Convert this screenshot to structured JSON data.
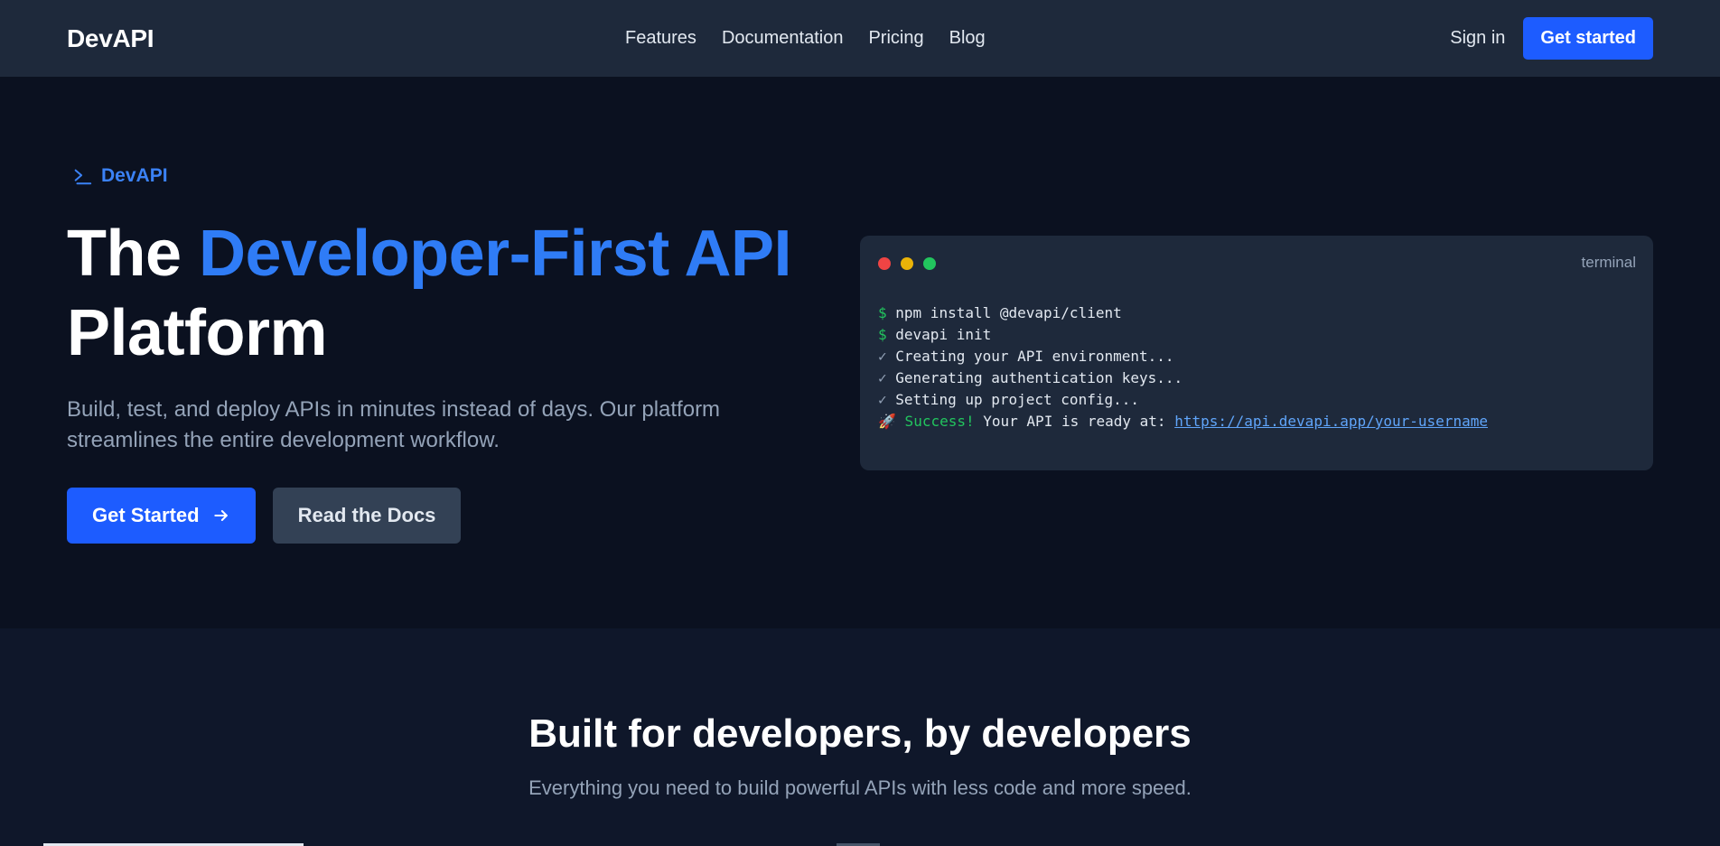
{
  "nav": {
    "brand": "DevAPI",
    "links": [
      "Features",
      "Documentation",
      "Pricing",
      "Blog"
    ],
    "sign_in": "Sign in",
    "cta": "Get started"
  },
  "hero": {
    "eyebrow": "DevAPI",
    "eyebrow_icon": "terminal-prompt-icon",
    "title_lead": "The ",
    "title_accent": "Developer-First API",
    "title_tail": "Platform",
    "subtitle": "Build, test, and deploy APIs in minutes instead of days. Our platform streamlines the entire development workflow.",
    "cta_primary": "Get Started",
    "cta_secondary": "Read the Docs"
  },
  "terminal": {
    "label": "terminal",
    "prompt": "$",
    "lines": {
      "cmd1": " npm install @devapi/client",
      "cmd2": " devapi init",
      "check_mark": "✓",
      "step1": " Creating your API environment...",
      "step2": " Generating authentication keys...",
      "step3": " Setting up project config...",
      "rocket": "🚀",
      "success": " Success!",
      "ready": " Your API is ready at: ",
      "url": "https://api.devapi.app/your-username"
    }
  },
  "features": {
    "title": "Built for developers, by developers",
    "subtitle": "Everything you need to build powerful APIs with less code and more speed."
  },
  "colors": {
    "accent": "#2f7cf6",
    "primary_button": "#1d5cff",
    "nav_bg": "#1e293b",
    "hero_bg": "#0b1120",
    "section_bg": "#0f172a",
    "terminal_bg": "#1e293b",
    "success_green": "#22c55e"
  }
}
